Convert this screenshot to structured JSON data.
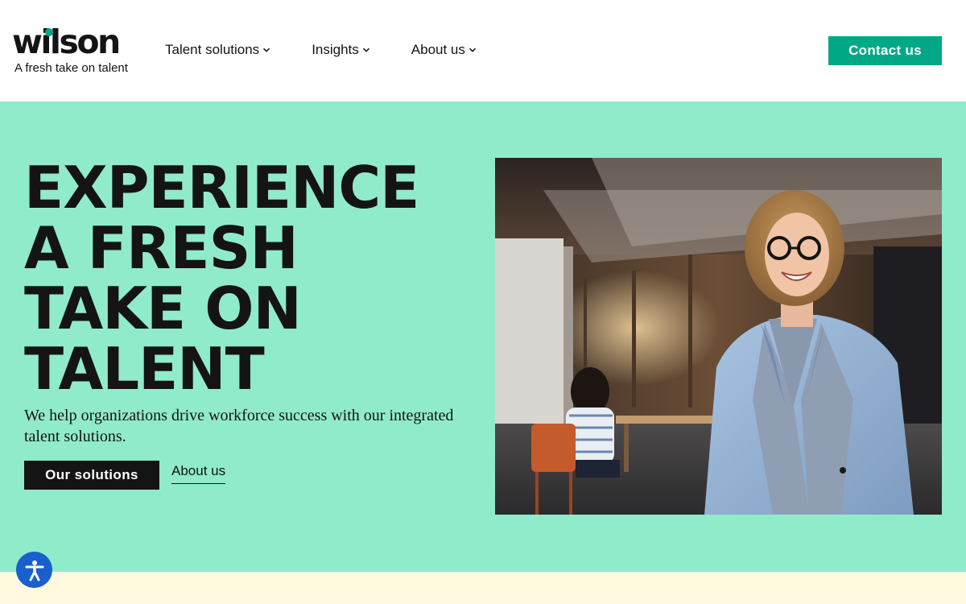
{
  "header": {
    "logo": {
      "wordmark": "wilson",
      "tagline": "A fresh take on talent"
    },
    "nav": [
      {
        "label": "Talent solutions"
      },
      {
        "label": "Insights"
      },
      {
        "label": "About us"
      }
    ],
    "contact_label": "Contact us"
  },
  "hero": {
    "title_lines": [
      "EXPERIENCE",
      "A FRESH",
      "TAKE ON",
      "TALENT"
    ],
    "subtitle": "We help organizations drive workforce success with our integrated talent solutions.",
    "primary_button": "Our solutions",
    "secondary_link": "About us",
    "photo_icon": "smiling-woman-office-photo"
  },
  "accessibility": {
    "icon": "accessibility-icon"
  },
  "colors": {
    "brand_green": "#00a886",
    "hero_background": "#90ebca",
    "text_dark": "#141414",
    "strip_background": "#fffadf",
    "a11y_blue": "#1a5fcf"
  }
}
